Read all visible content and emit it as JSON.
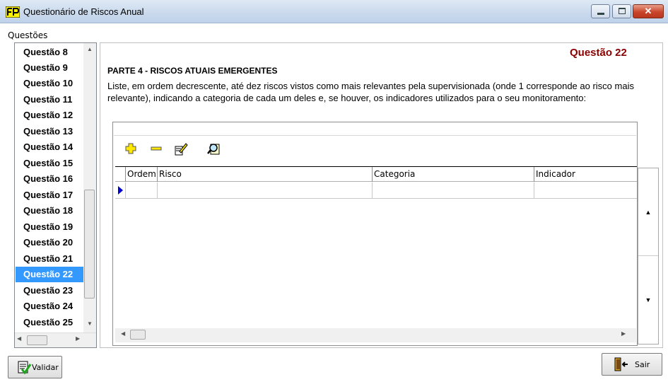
{
  "window": {
    "title": "Questionário de Riscos Anual",
    "close_glyph": "✕"
  },
  "sidebar": {
    "group_label": "Questões",
    "items": [
      {
        "label": "Questão 8"
      },
      {
        "label": "Questão 9"
      },
      {
        "label": "Questão 10"
      },
      {
        "label": "Questão 11"
      },
      {
        "label": "Questão 12"
      },
      {
        "label": "Questão 13"
      },
      {
        "label": "Questão 14"
      },
      {
        "label": "Questão 15"
      },
      {
        "label": "Questão 16"
      },
      {
        "label": "Questão 17"
      },
      {
        "label": "Questão 18"
      },
      {
        "label": "Questão 19"
      },
      {
        "label": "Questão 20"
      },
      {
        "label": "Questão 21"
      },
      {
        "label": "Questão 22",
        "selected": true
      },
      {
        "label": "Questão 23"
      },
      {
        "label": "Questão 24"
      },
      {
        "label": "Questão 25"
      }
    ]
  },
  "question": {
    "number": "Questão 22",
    "section": "PARTE 4 - RISCOS ATUAIS EMERGENTES",
    "text": "Liste, em ordem decrescente, até dez riscos vistos como mais relevantes pela supervisionada (onde 1 corresponde ao risco mais relevante), indicando a categoria de cada um deles e, se houver, os indicadores utilizados para o seu monitoramento:"
  },
  "toolbar": {
    "icons": [
      "add-icon",
      "remove-icon",
      "edit-icon",
      "search-icon"
    ]
  },
  "grid": {
    "columns": [
      "Ordem",
      "Risco",
      "Categoria",
      "Indicador"
    ],
    "rows": [
      [
        "",
        "",
        "",
        ""
      ]
    ]
  },
  "buttons": {
    "validar": "Validar",
    "sair": "Sair"
  },
  "colors": {
    "selected_bg": "#3399ff",
    "question_number": "#8b0000",
    "row_indicator": "#0000cc"
  }
}
